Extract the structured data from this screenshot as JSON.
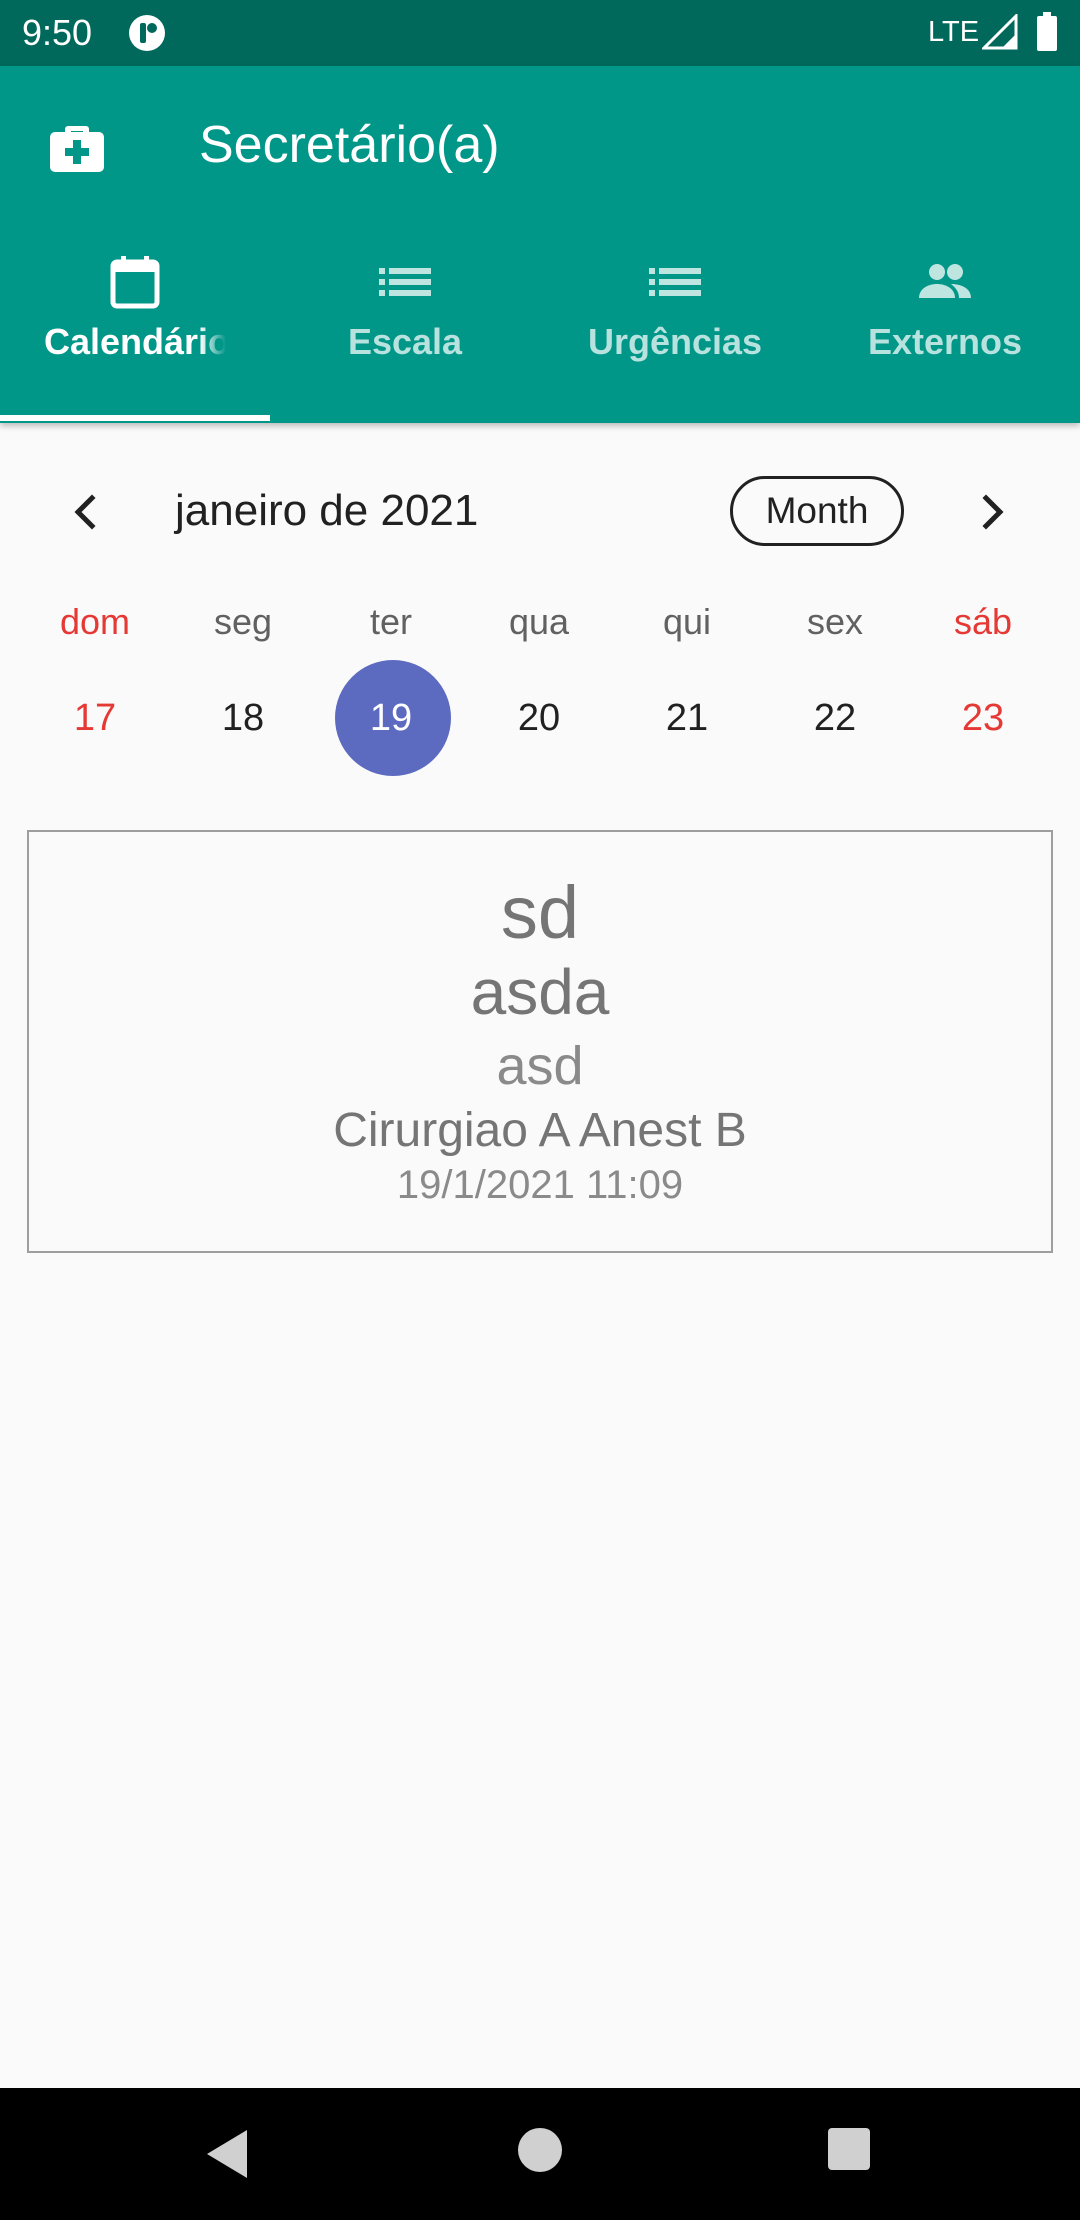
{
  "status_bar": {
    "time": "9:50",
    "network": "LTE",
    "icons": [
      "app-notification-icon",
      "signal-icon",
      "battery-icon"
    ]
  },
  "app_bar": {
    "icon": "medical-kit-icon",
    "title": "Secretário(a)"
  },
  "tabs": [
    {
      "label": "Calendário",
      "icon": "calendar-icon",
      "selected": true
    },
    {
      "label": "Escala",
      "icon": "list-icon",
      "selected": false
    },
    {
      "label": "Urgências",
      "icon": "list-icon",
      "selected": false
    },
    {
      "label": "Externos",
      "icon": "people-icon",
      "selected": false
    }
  ],
  "calendar": {
    "month_title": "janeiro de 2021",
    "view_toggle": "Month",
    "prev_icon": "chevron-left-icon",
    "next_icon": "chevron-right-icon",
    "weekdays": [
      "dom",
      "seg",
      "ter",
      "qua",
      "qui",
      "sex",
      "sáb"
    ],
    "days": [
      "17",
      "18",
      "19",
      "20",
      "21",
      "22",
      "23"
    ],
    "selected_day": "19",
    "colors": {
      "weekend": "#e53935",
      "selected": "#5c6bc0"
    }
  },
  "event": {
    "title": "sd",
    "subtitle": "asda",
    "description": "asd",
    "team": "Cirurgiao A Anest B",
    "datetime": "19/1/2021  11:09"
  },
  "theme": {
    "primary": "#009688",
    "primary_dark": "#00695c"
  },
  "nav_bar": {
    "icons": [
      "back-icon",
      "home-icon",
      "recents-icon"
    ]
  }
}
